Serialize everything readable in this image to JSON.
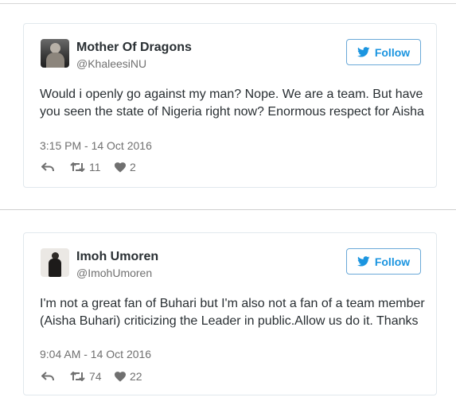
{
  "tweets": [
    {
      "name": "Mother Of Dragons",
      "handle": "@KhaleesiNU",
      "follow_label": "Follow",
      "text": "Would i openly go against my man? Nope. We are a team. But have you seen the state of Nigeria right now? Enormous respect for Aisha",
      "timestamp": "3:15 PM - 14 Oct 2016",
      "retweets": "11",
      "likes": "2"
    },
    {
      "name": "Imoh Umoren",
      "handle": "@ImohUmoren",
      "follow_label": "Follow",
      "text": "I'm not a great fan of Buhari but I'm also not a fan of a team member (Aisha Buhari) criticizing the Leader in public.Allow us do it. Thanks",
      "timestamp": "9:04 AM - 14 Oct 2016",
      "retweets": "74",
      "likes": "22"
    }
  ],
  "colors": {
    "accent": "#1b95e0",
    "text": "#292f33",
    "muted": "#707070",
    "border": "#e1e8ed"
  }
}
